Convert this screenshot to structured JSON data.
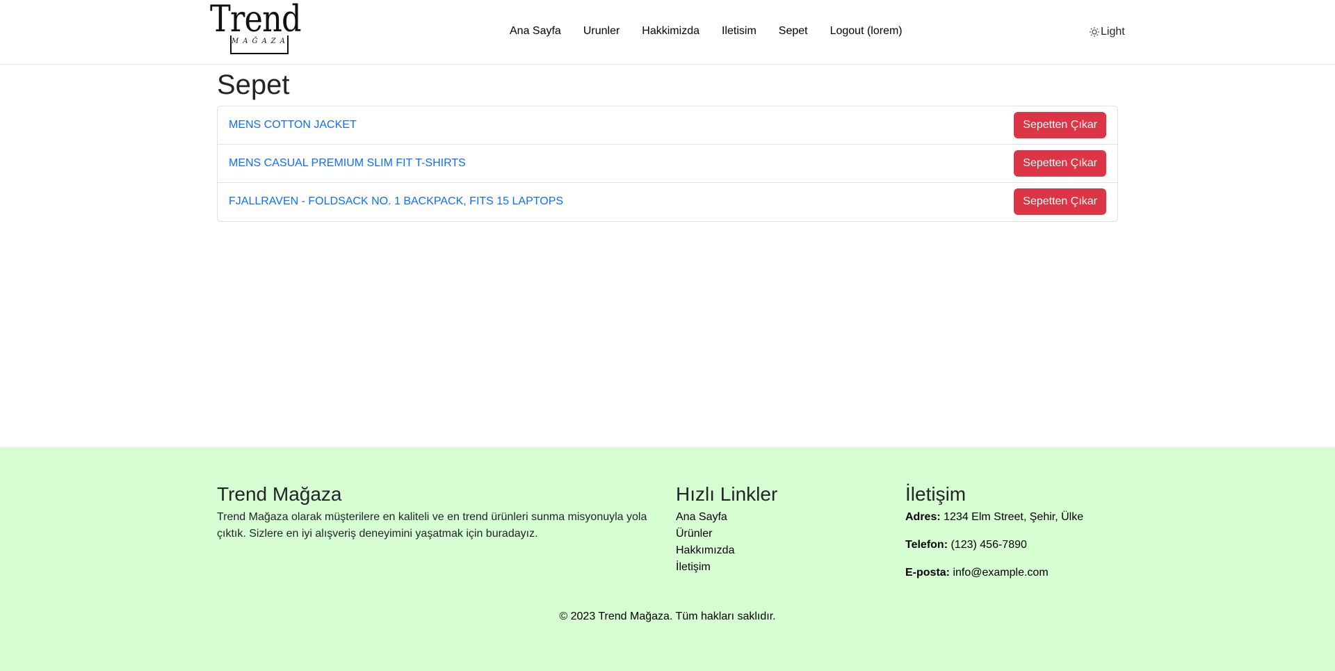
{
  "brand": {
    "name": "Trend",
    "subtitle": "MAĞAZA"
  },
  "nav": {
    "links": [
      "Ana Sayfa",
      "Urunler",
      "Hakkimizda",
      "Iletisim",
      "Sepet",
      "Logout (lorem)"
    ],
    "theme_label": "Light"
  },
  "main": {
    "title": "Sepet",
    "items": [
      {
        "name": "MENS COTTON JACKET",
        "button": "Sepetten Çıkar"
      },
      {
        "name": "MENS CASUAL PREMIUM SLIM FIT T-SHIRTS",
        "button": "Sepetten Çıkar"
      },
      {
        "name": "FJALLRAVEN - FOLDSACK NO. 1 BACKPACK, FITS 15 LAPTOPS",
        "button": "Sepetten Çıkar"
      }
    ]
  },
  "footer": {
    "about": {
      "title": "Trend Mağaza",
      "text": "Trend Mağaza olarak müşterilere en kaliteli ve en trend ürünleri sunma misyonuyla yola çıktık. Sizlere en iyi alışveriş deneyimini yaşatmak için buradayız."
    },
    "quick_links": {
      "title": "Hızlı Linkler",
      "links": [
        "Ana Sayfa",
        "Ürünler",
        "Hakkımızda",
        "İletişim"
      ]
    },
    "contact": {
      "title": "İletişim",
      "address_label": "Adres:",
      "address": "1234 Elm Street, Şehir, Ülke",
      "phone_label": "Telefon:",
      "phone": "(123) 456-7890",
      "email_label": "E-posta:",
      "email": "info@example.com"
    },
    "copyright": "© 2023 Trend Mağaza. Tüm hakları saklıdır."
  },
  "colors": {
    "link": "#0d6efd",
    "danger": "#dc3545",
    "footer_bg": "#d7fed3"
  }
}
